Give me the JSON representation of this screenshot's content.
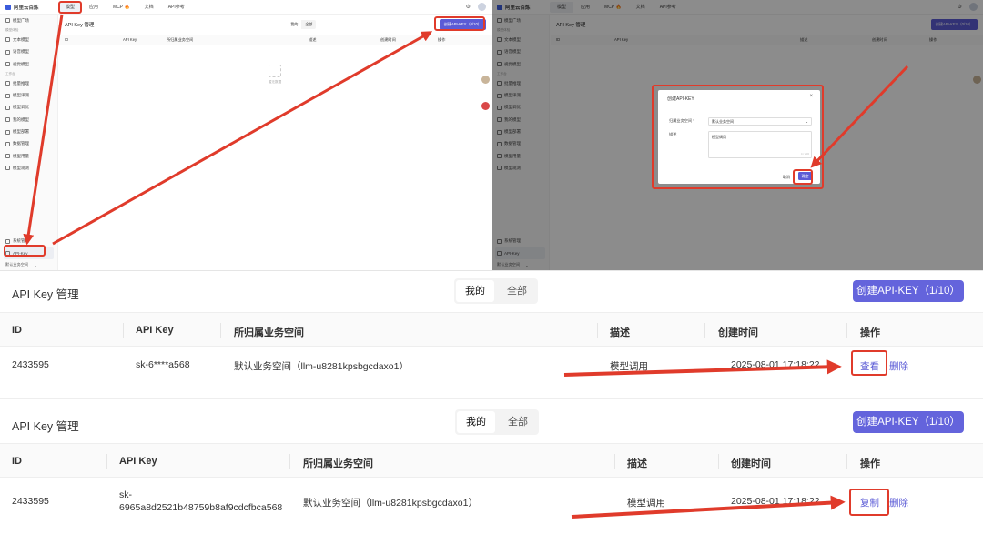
{
  "app": {
    "name": "阿里云百炼",
    "nav": [
      "模型",
      "应用",
      "MCP 🔥",
      "文档",
      "API参考"
    ]
  },
  "sidebar": {
    "items": [
      {
        "type": "item",
        "label": "模型广场"
      },
      {
        "type": "group",
        "label": "模型体验"
      },
      {
        "type": "item",
        "label": "文本模型"
      },
      {
        "type": "item",
        "label": "语音模型"
      },
      {
        "type": "item",
        "label": "视觉模型"
      },
      {
        "type": "group",
        "label": "工作台"
      },
      {
        "type": "item",
        "label": "批量推理"
      },
      {
        "type": "item",
        "label": "模型评测"
      },
      {
        "type": "item",
        "label": "模型调优"
      },
      {
        "type": "item",
        "label": "我的模型"
      },
      {
        "type": "item",
        "label": "模型部署"
      },
      {
        "type": "item",
        "label": "数据管理"
      },
      {
        "type": "item",
        "label": "模型用量"
      },
      {
        "type": "item",
        "label": "模型观测"
      }
    ],
    "bottom": [
      "系统管理",
      "API-Key"
    ],
    "workspace": "默认业务空间"
  },
  "mini": {
    "title": "API Key 管理",
    "seg": [
      "我的",
      "全部"
    ],
    "create_btn": "创建API-KEY（0/10）",
    "columns": [
      "ID",
      "API Key",
      "所归属业务空间",
      "描述",
      "创建时间",
      "操作"
    ],
    "empty": "暂无数据"
  },
  "modal": {
    "title": "创建API-KEY",
    "workspace_label": "归属业务空间 *",
    "workspace_value": "默认业务空间",
    "desc_label": "描述",
    "desc_value": "模型调用",
    "count": "4 / 200",
    "cancel": "取消",
    "ok": "确定"
  },
  "table1": {
    "title": "API Key 管理",
    "seg": [
      "我的",
      "全部"
    ],
    "create_btn": "创建API-KEY（1/10）",
    "columns": [
      "ID",
      "API Key",
      "所归属业务空间",
      "描述",
      "创建时间",
      "操作"
    ],
    "row": {
      "id": "2433595",
      "key": "sk-6****a568",
      "workspace": "默认业务空间（llm-u8281kpsbgcdaxo1）",
      "desc": "模型调用",
      "created": "2025-08-01 17:18:22",
      "action_view": "查看",
      "action_delete": "删除"
    }
  },
  "table2": {
    "title": "API Key 管理",
    "seg": [
      "我的",
      "全部"
    ],
    "create_btn": "创建API-KEY（1/10）",
    "columns": [
      "ID",
      "API Key",
      "所归属业务空间",
      "描述",
      "创建时间",
      "操作"
    ],
    "row": {
      "id": "2433595",
      "key_line1": "sk-",
      "key_line2": "6965a8d2521b48759b8af9cdcfbca568",
      "workspace": "默认业务空间（llm-u8281kpsbgcdaxo1）",
      "desc": "模型调用",
      "created": "2025-08-01 17:18:22",
      "action_copy": "复制",
      "action_delete": "删除"
    }
  },
  "colors": {
    "accent": "#6464dc",
    "highlight": "#e03b2b"
  }
}
